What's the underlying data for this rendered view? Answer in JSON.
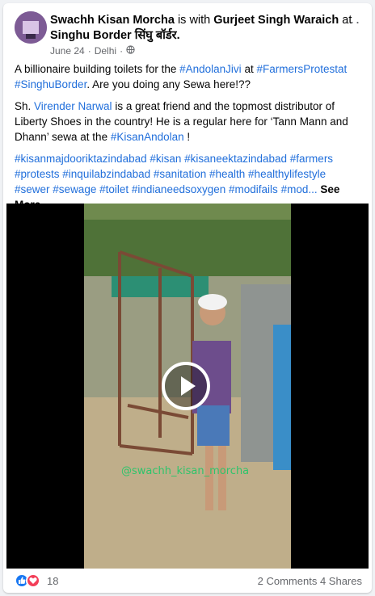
{
  "post": {
    "author": "Swachh Kisan Morcha",
    "with_text": "is with",
    "tagged": "Gurjeet Singh Waraich",
    "at_text": "at",
    "location": "Singhu Border सिंघु बॉर्डर.",
    "date": "June 24",
    "place": "Delhi",
    "separator": "·",
    "more_label": "···"
  },
  "body": {
    "p1_a": "A billionaire building toilets for the ",
    "p1_tag1": "#AndolanJivi",
    "p1_b": " at ",
    "p1_tag2": "#FarmersProtestat",
    "p1_c": " ",
    "p1_tag3": "#SinghuBorder",
    "p1_d": ". Are you doing any Sewa here!??",
    "p2_a": "Sh. ",
    "p2_name": "Virender Narwal",
    "p2_b": " is a great friend and the topmost distributor of Liberty Shoes in the country! He is a regular here for ‘Tann Mann and Dhann’ sewa at the ",
    "p2_tag": "#KisanAndolan",
    "p2_c": " !",
    "hashtags": [
      "#kisanmajdooriktazindabad",
      "#kisan",
      "#kisaneektazindabad",
      "#farmers",
      "#protests",
      "#inquilabzindabad",
      "#sanitation",
      "#health",
      "#healthylifestyle",
      "#sewer",
      "#sewage",
      "#toilet",
      "#indianeedsoxygen",
      "#modifails",
      "#mod..."
    ],
    "see_more": "See More"
  },
  "video": {
    "watermark": "@swachh_kisan_morcha"
  },
  "footer": {
    "reaction_count": "18",
    "comments": "2 Comments",
    "shares": "4 Shares"
  },
  "colors": {
    "link": "#216fdb",
    "like": "#1877f2",
    "love": "#f33e58",
    "watermark": "#2fc46b"
  }
}
